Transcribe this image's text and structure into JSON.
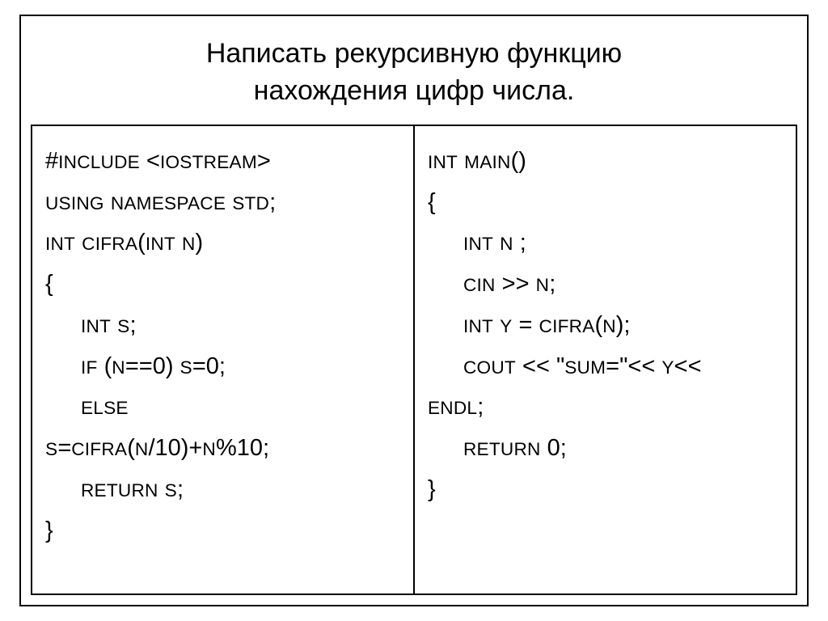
{
  "title_line1": "Написать рекурсивную функцию",
  "title_line2": "нахождения цифр числа.",
  "left": {
    "l1_a": "#",
    "l1_b": "include",
    "l1_c": " <",
    "l1_d": "iostream",
    "l1_e": ">",
    "l2_a": "using",
    "l2_b": " ",
    "l2_c": "namespace",
    "l2_d": " ",
    "l2_e": "std",
    "l2_f": ";",
    "l3_a": "int",
    "l3_b": " ",
    "l3_c": "cifra",
    "l3_d": "(",
    "l3_e": "int",
    "l3_f": " ",
    "l3_g": "n",
    "l3_h": ")",
    "l4": "{",
    "l5_a": "int",
    "l5_b": " ",
    "l5_c": "s",
    "l5_d": ";",
    "l6_a": "if",
    "l6_b": " (",
    "l6_c": "n",
    "l6_d": "==0) ",
    "l6_e": "s",
    "l6_f": "=0;",
    "l7_a": "else",
    "l8_a": "s",
    "l8_b": "=",
    "l8_c": "cifra",
    "l8_d": "(",
    "l8_e": "n",
    "l8_f": "/10)+",
    "l8_g": "n",
    "l8_h": "%10;",
    "l9_a": "return",
    "l9_b": " ",
    "l9_c": "s",
    "l9_d": ";",
    "l10": "}"
  },
  "right": {
    "l1_a": "int",
    "l1_b": " ",
    "l1_c": "main",
    "l1_d": "()",
    "l2": "{",
    "l3_a": "int",
    "l3_b": " ",
    "l3_c": "n",
    "l3_d": " ;",
    "l4_a": "cin",
    "l4_b": " >> ",
    "l4_c": "n",
    "l4_d": ";",
    "l5_a": "int",
    "l5_b": " ",
    "l5_c": "y",
    "l5_d": " = ",
    "l5_e": "cifra",
    "l5_f": "(",
    "l5_g": "n",
    "l5_h": ");",
    "l6_a": "cout",
    "l6_b": " << \"",
    "l6_c": "sum",
    "l6_d": "=\"<< ",
    "l6_e": "y",
    "l6_f": "<<",
    "l7_a": "endl",
    "l7_b": ";",
    "l8_a": "return",
    "l8_b": " 0;",
    "l9": "}"
  }
}
